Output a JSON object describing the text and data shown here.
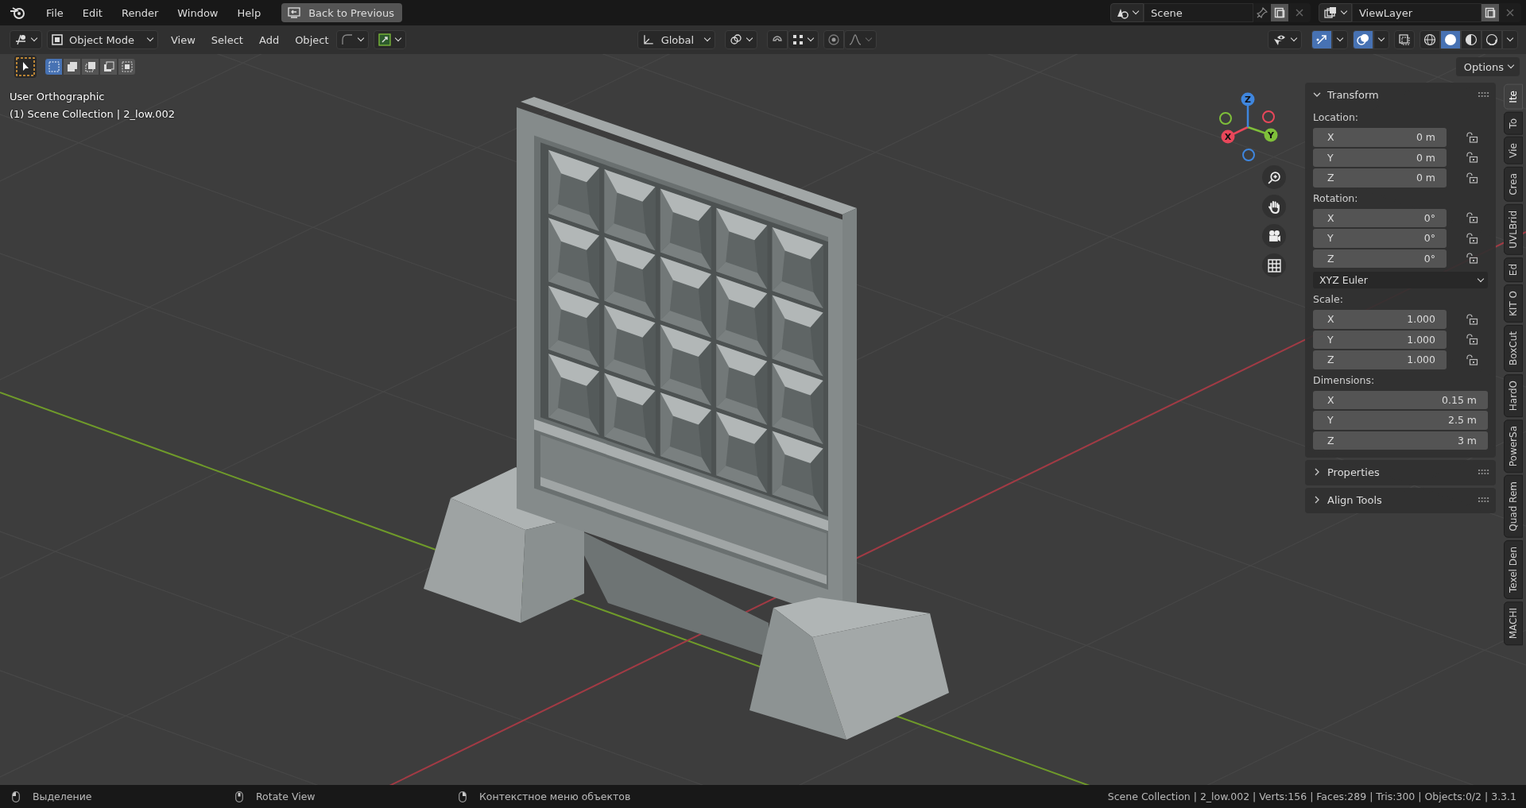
{
  "top_bar": {
    "menus": [
      "File",
      "Edit",
      "Render",
      "Window",
      "Help"
    ],
    "back_button": "Back to Previous",
    "scene": "Scene",
    "view_layer": "ViewLayer"
  },
  "header": {
    "mode": "Object Mode",
    "menus": [
      "View",
      "Select",
      "Add",
      "Object"
    ],
    "orientation": "Global",
    "toggles": [
      {
        "kind": "gizmo",
        "selected": true
      },
      {
        "kind": "overlay",
        "selected": true
      }
    ],
    "shading": [
      {
        "kind": "wireframe",
        "selected": false
      },
      {
        "kind": "solid",
        "selected": true
      },
      {
        "kind": "material",
        "selected": false
      },
      {
        "kind": "rendered",
        "selected": false
      }
    ]
  },
  "tool_settings": {
    "select_modes": [
      {
        "kind": "set",
        "selected": true
      },
      {
        "kind": "extend",
        "selected": false
      },
      {
        "kind": "subtract",
        "selected": false
      },
      {
        "kind": "difference",
        "selected": false
      },
      {
        "kind": "intersect",
        "selected": false
      }
    ],
    "options": "Options"
  },
  "viewport": {
    "view_name": "User Orthographic",
    "collection": "(1) Scene Collection | 2_low.002",
    "gizmo_axes": [
      {
        "label": "X",
        "color": "#e8475a"
      },
      {
        "label": "Y",
        "color": "#7fbf3a"
      },
      {
        "label": "Z",
        "color": "#3f86de"
      }
    ]
  },
  "sidebar": {
    "panels": [
      {
        "title": "Transform",
        "expanded": true,
        "groups": [
          {
            "label": "Location:",
            "lockable": true,
            "rows": [
              {
                "axis": "X",
                "value": "0 m"
              },
              {
                "axis": "Y",
                "value": "0 m"
              },
              {
                "axis": "Z",
                "value": "0 m"
              }
            ]
          },
          {
            "label": "Rotation:",
            "lockable": true,
            "rows": [
              {
                "axis": "X",
                "value": "0°"
              },
              {
                "axis": "Y",
                "value": "0°"
              },
              {
                "axis": "Z",
                "value": "0°"
              }
            ],
            "mode": "XYZ Euler"
          },
          {
            "label": "Scale:",
            "lockable": true,
            "rows": [
              {
                "axis": "X",
                "value": "1.000"
              },
              {
                "axis": "Y",
                "value": "1.000"
              },
              {
                "axis": "Z",
                "value": "1.000"
              }
            ]
          },
          {
            "label": "Dimensions:",
            "lockable": false,
            "rows": [
              {
                "axis": "X",
                "value": "0.15 m"
              },
              {
                "axis": "Y",
                "value": "2.5 m"
              },
              {
                "axis": "Z",
                "value": "3 m"
              }
            ]
          }
        ]
      },
      {
        "title": "Properties",
        "expanded": false
      },
      {
        "title": "Align Tools",
        "expanded": false
      }
    ],
    "tabs": [
      {
        "label": "Ite",
        "selected": true
      },
      {
        "label": "To",
        "selected": false
      },
      {
        "label": "Vie",
        "selected": false
      },
      {
        "label": "Crea",
        "selected": false
      },
      {
        "label": "UVLBrid",
        "selected": false
      },
      {
        "label": "Ed",
        "selected": false
      },
      {
        "label": "KIT O",
        "selected": false
      },
      {
        "label": "BoxCut",
        "selected": false
      },
      {
        "label": "HardO",
        "selected": false
      },
      {
        "label": "PowerSa",
        "selected": false
      },
      {
        "label": "Quad Rem",
        "selected": false
      },
      {
        "label": "Texel Den",
        "selected": false
      },
      {
        "label": "MACHI",
        "selected": false
      }
    ]
  },
  "status_bar": {
    "hints": [
      {
        "kind": "left",
        "text": "Выделение"
      },
      {
        "kind": "middle",
        "text": "Rotate View"
      },
      {
        "kind": "right",
        "text": "Контекстное меню объектов"
      }
    ],
    "stats": "Scene Collection | 2_low.002 | Verts:156 | Faces:289 | Tris:300 | Objects:0/2 | 3.3.1"
  }
}
